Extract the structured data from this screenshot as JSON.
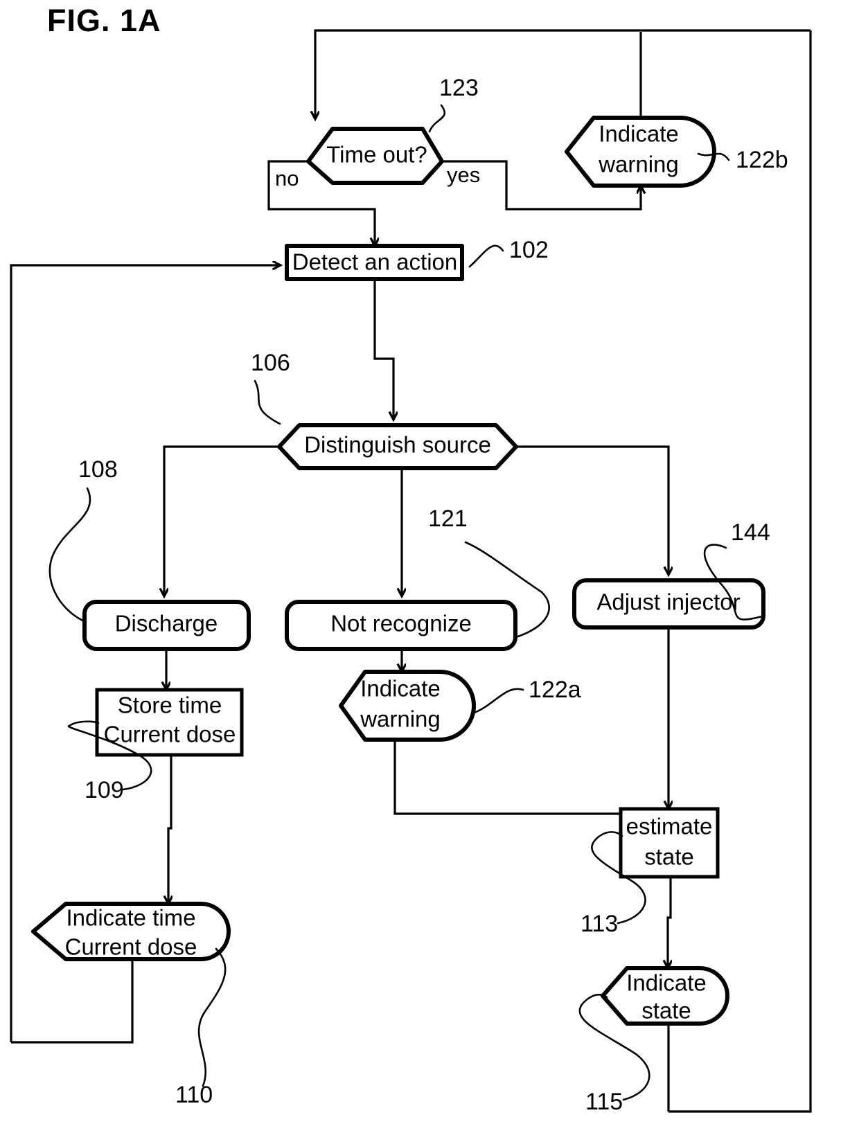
{
  "figure": {
    "title": "FIG. 1A",
    "type": "patent-flowchart"
  },
  "nodes": [
    {
      "id": "timeout",
      "label_line1": "Time out?",
      "label_line2": "",
      "ref": "123",
      "shape": "hexagon"
    },
    {
      "id": "indicate-warn-b",
      "label_line1": "Indicate",
      "label_line2": "warning",
      "ref": "122b",
      "shape": "flag"
    },
    {
      "id": "detect-action",
      "label_line1": "Detect an action",
      "label_line2": "",
      "ref": "102",
      "shape": "rect"
    },
    {
      "id": "distinguish",
      "label_line1": "Distinguish source",
      "label_line2": "",
      "ref": "106",
      "shape": "hexagon"
    },
    {
      "id": "discharge",
      "label_line1": "Discharge",
      "label_line2": "",
      "ref": "108",
      "shape": "round-rect"
    },
    {
      "id": "not-recognize",
      "label_line1": "Not recognize",
      "label_line2": "",
      "ref": "121",
      "shape": "round-rect"
    },
    {
      "id": "adjust-injector",
      "label_line1": "Adjust injector",
      "label_line2": "",
      "ref": "144",
      "shape": "round-rect"
    },
    {
      "id": "store-time",
      "label_line1": "Store time",
      "label_line2": "Current dose",
      "ref": "109",
      "shape": "rect"
    },
    {
      "id": "indicate-warn-a",
      "label_line1": "Indicate",
      "label_line2": "warning",
      "ref": "122a",
      "shape": "flag"
    },
    {
      "id": "estimate-state",
      "label_line1": "estimate",
      "label_line2": "state",
      "ref": "113",
      "shape": "rect"
    },
    {
      "id": "indicate-time",
      "label_line1": "Indicate time",
      "label_line2": "Current dose",
      "ref": "110",
      "shape": "flag"
    },
    {
      "id": "indicate-state",
      "label_line1": "Indicate",
      "label_line2": "state",
      "ref": "115",
      "shape": "flag"
    }
  ],
  "edge_labels": {
    "no": "no",
    "yes": "yes"
  },
  "colors": {
    "stroke": "#000000",
    "background": "#ffffff"
  }
}
